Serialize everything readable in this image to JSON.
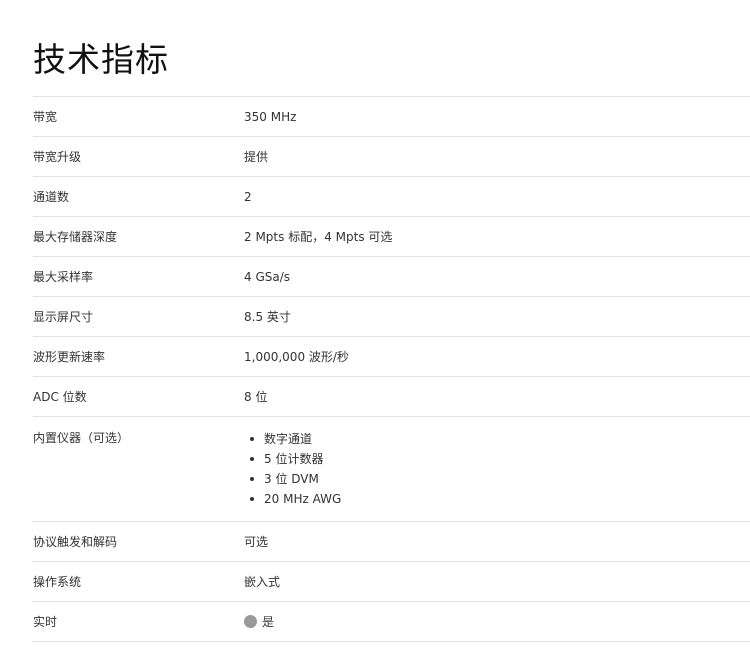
{
  "title": "技术指标",
  "specs": [
    {
      "label": "带宽",
      "value": "350 MHz"
    },
    {
      "label": "带宽升级",
      "value": "提供"
    },
    {
      "label": "通道数",
      "value": "2"
    },
    {
      "label": "最大存储器深度",
      "value": "2 Mpts 标配，4 Mpts 可选"
    },
    {
      "label": "最大采样率",
      "value": "4 GSa/s"
    },
    {
      "label": "显示屏尺寸",
      "value": "8.5 英寸"
    },
    {
      "label": "波形更新速率",
      "value": "1,000,000 波形/秒"
    },
    {
      "label": "ADC 位数",
      "value": "8 位"
    }
  ],
  "instruments": {
    "label": "内置仪器（可选）",
    "items": [
      "数字通道",
      "5 位计数器",
      "3 位 DVM",
      "20 MHz AWG"
    ]
  },
  "specs_after": [
    {
      "label": "协议触发和解码",
      "value": "可选"
    },
    {
      "label": "操作系统",
      "value": "嵌入式"
    }
  ],
  "realtime": {
    "label": "实时",
    "value": "是",
    "icon": "circle-icon",
    "icon_color": "#999999"
  }
}
